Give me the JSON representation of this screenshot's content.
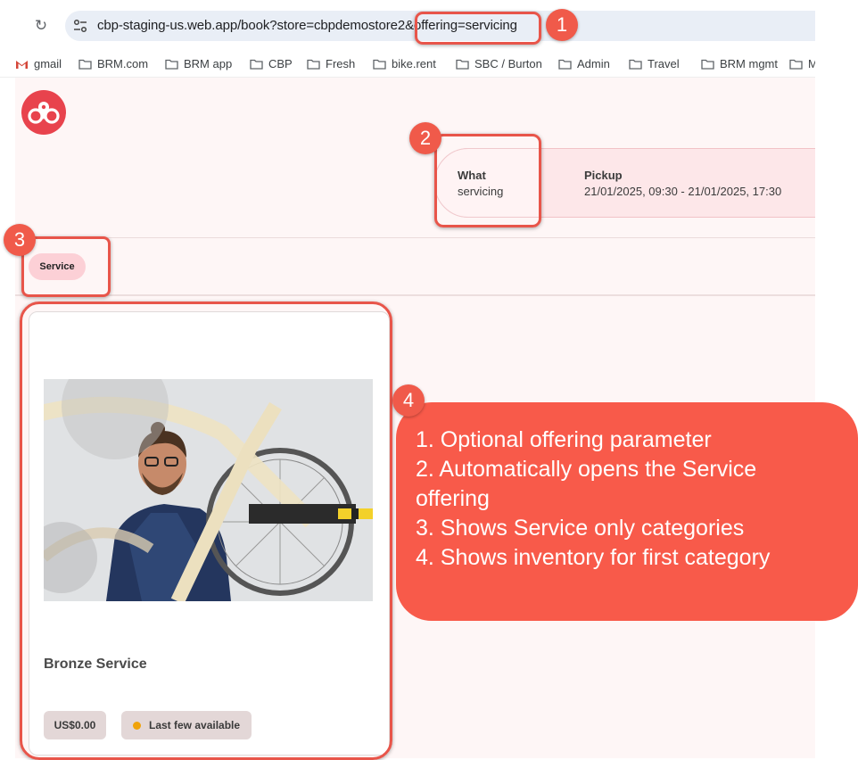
{
  "browser": {
    "url": "cbp-staging-us.web.app/book?store=cbpdemostore2&offering=servicing",
    "bookmarks": [
      {
        "label": "gmail",
        "icon": "gmail-icon"
      },
      {
        "label": "BRM.com",
        "icon": "folder-icon"
      },
      {
        "label": "BRM app",
        "icon": "folder-icon"
      },
      {
        "label": "CBP",
        "icon": "folder-icon"
      },
      {
        "label": "Fresh",
        "icon": "folder-icon"
      },
      {
        "label": "bike.rent",
        "icon": "folder-icon"
      },
      {
        "label": "SBC / Burton",
        "icon": "folder-icon"
      },
      {
        "label": "Admin",
        "icon": "folder-icon"
      },
      {
        "label": "Travel",
        "icon": "folder-icon"
      },
      {
        "label": "BRM mgmt",
        "icon": "folder-icon"
      },
      {
        "label": "M",
        "icon": "folder-icon"
      }
    ]
  },
  "booking": {
    "what_label": "What",
    "what_value": "servicing",
    "pickup_label": "Pickup",
    "pickup_value": "21/01/2025, 09:30 - 21/01/2025, 17:30"
  },
  "categories": [
    "Service"
  ],
  "card": {
    "title": "Bronze Service",
    "price": "US$0.00",
    "availability": "Last few available",
    "availability_color": "#f0a30a"
  },
  "annotations": {
    "badges": [
      "1",
      "2",
      "3",
      "4"
    ],
    "notes": [
      "1. Optional offering parameter",
      "2. Automatically opens the Service",
      "offering",
      "3. Shows Service only categories",
      "4. Shows inventory for first category"
    ],
    "accent_color": "#f05a4a"
  }
}
